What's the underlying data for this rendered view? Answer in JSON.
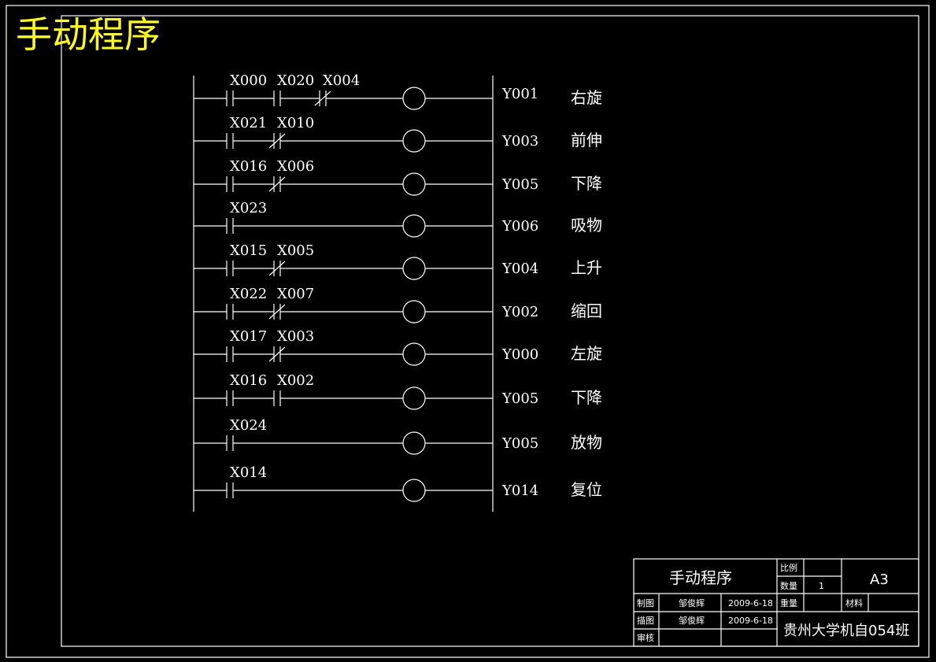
{
  "page_title": "手动程序",
  "rungs": [
    {
      "contacts": [
        {
          "label": "X000",
          "type": "NO"
        },
        {
          "label": "X020",
          "type": "NO"
        },
        {
          "label": "X004",
          "type": "NC"
        }
      ],
      "output": "Y001",
      "description": "右旋"
    },
    {
      "contacts": [
        {
          "label": "X021",
          "type": "NO"
        },
        {
          "label": "X010",
          "type": "NC"
        }
      ],
      "output": "Y003",
      "description": "前伸"
    },
    {
      "contacts": [
        {
          "label": "X016",
          "type": "NO"
        },
        {
          "label": "X006",
          "type": "NC"
        }
      ],
      "output": "Y005",
      "description": "下降"
    },
    {
      "contacts": [
        {
          "label": "X023",
          "type": "NO"
        }
      ],
      "output": "Y006",
      "description": "吸物"
    },
    {
      "contacts": [
        {
          "label": "X015",
          "type": "NO"
        },
        {
          "label": "X005",
          "type": "NC"
        }
      ],
      "output": "Y004",
      "description": "上升"
    },
    {
      "contacts": [
        {
          "label": "X022",
          "type": "NO"
        },
        {
          "label": "X007",
          "type": "NC"
        }
      ],
      "output": "Y002",
      "description": "缩回"
    },
    {
      "contacts": [
        {
          "label": "X017",
          "type": "NO"
        },
        {
          "label": "X003",
          "type": "NC"
        }
      ],
      "output": "Y000",
      "description": "左旋"
    },
    {
      "contacts": [
        {
          "label": "X016",
          "type": "NO"
        },
        {
          "label": "X002",
          "type": "NO"
        }
      ],
      "output": "Y005",
      "description": "下降"
    },
    {
      "contacts": [
        {
          "label": "X024",
          "type": "NO"
        }
      ],
      "output": "Y005",
      "description": "放物"
    },
    {
      "contacts": [
        {
          "label": "X014",
          "type": "NO"
        }
      ],
      "output": "Y014",
      "description": "复位"
    }
  ],
  "title_block": {
    "drawing_name": "手动程序",
    "scale_label": "比例",
    "quantity_label": "数量",
    "quantity_value": "1",
    "sheet_size": "A3",
    "drawn_label": "制图",
    "drawn_by": "邹俊辉",
    "drawn_date": "2009-6-18",
    "weight_label": "重量",
    "material_label": "材料",
    "traced_label": "描图",
    "traced_by": "邹俊辉",
    "traced_date": "2009-6-18",
    "review_label": "审核",
    "organization": "贵州大学机自054班"
  }
}
